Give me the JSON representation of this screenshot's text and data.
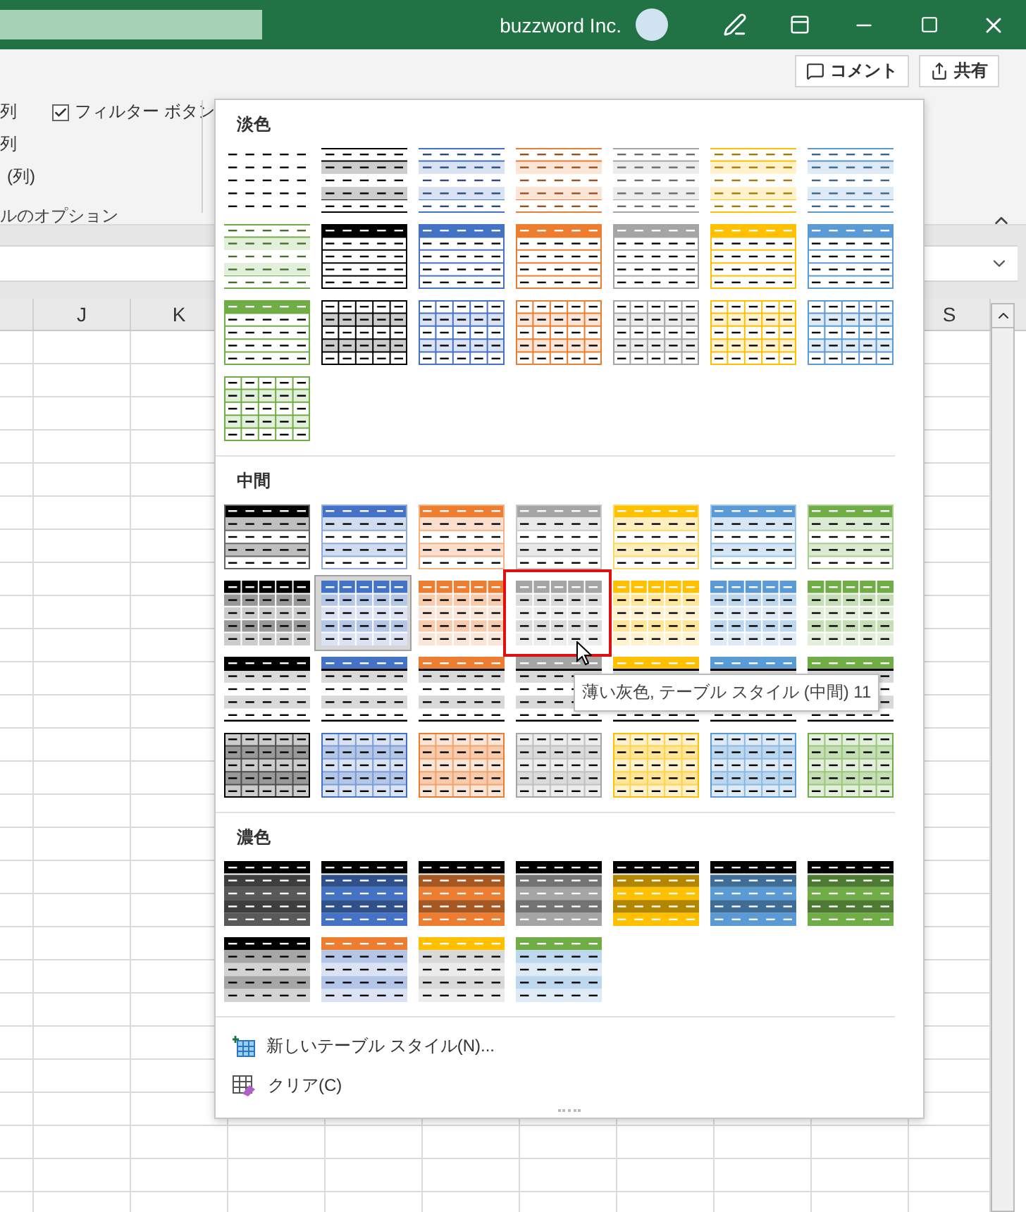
{
  "title_bar": {
    "account": "buzzword Inc."
  },
  "ribbon": {
    "buttons": [
      {
        "kind": "comment",
        "label": "コメント"
      },
      {
        "kind": "share",
        "label": "共有"
      }
    ],
    "lines": [
      {
        "text": "列",
        "checkbox": {
          "label": "フィルター ボタン",
          "checked": true
        }
      },
      {
        "text": "列"
      },
      {
        "text": "(列)"
      }
    ],
    "group_label": "ルのオプション"
  },
  "sheet": {
    "columns": [
      "J",
      "K",
      "S"
    ]
  },
  "gallery": {
    "sections": [
      {
        "title": "淡色",
        "styles": [
          {
            "kind": "plain",
            "color": "#000000",
            "selected": false,
            "hovered": false
          },
          {
            "kind": "banded",
            "color": "#000000",
            "selected": false,
            "hovered": false
          },
          {
            "kind": "banded",
            "color": "#4472c4",
            "selected": false,
            "hovered": false
          },
          {
            "kind": "banded",
            "color": "#ed7d31",
            "selected": false,
            "hovered": false
          },
          {
            "kind": "banded",
            "color": "#a5a5a5",
            "selected": false,
            "hovered": false
          },
          {
            "kind": "banded",
            "color": "#ffc000",
            "selected": false,
            "hovered": false
          },
          {
            "kind": "banded",
            "color": "#5b9bd5",
            "selected": false,
            "hovered": false
          },
          {
            "kind": "banded",
            "color": "#70ad47",
            "selected": false,
            "hovered": false
          },
          {
            "kind": "header",
            "color": "#000000",
            "selected": false,
            "hovered": false
          },
          {
            "kind": "header",
            "color": "#4472c4",
            "selected": false,
            "hovered": false
          },
          {
            "kind": "header",
            "color": "#ed7d31",
            "selected": false,
            "hovered": false
          },
          {
            "kind": "header",
            "color": "#a5a5a5",
            "selected": false,
            "hovered": false
          },
          {
            "kind": "header",
            "color": "#ffc000",
            "selected": false,
            "hovered": false
          },
          {
            "kind": "header",
            "color": "#5b9bd5",
            "selected": false,
            "hovered": false
          },
          {
            "kind": "header",
            "color": "#70ad47",
            "selected": false,
            "hovered": false
          },
          {
            "kind": "grid",
            "color": "#000000",
            "selected": false,
            "hovered": false
          },
          {
            "kind": "grid",
            "color": "#4472c4",
            "selected": false,
            "hovered": false
          },
          {
            "kind": "grid",
            "color": "#ed7d31",
            "selected": false,
            "hovered": false
          },
          {
            "kind": "grid",
            "color": "#a5a5a5",
            "selected": false,
            "hovered": false
          },
          {
            "kind": "grid",
            "color": "#ffc000",
            "selected": false,
            "hovered": false
          },
          {
            "kind": "grid",
            "color": "#5b9bd5",
            "selected": false,
            "hovered": false
          },
          {
            "kind": "grid",
            "color": "#70ad47",
            "selected": false,
            "hovered": false
          }
        ]
      },
      {
        "title": "中間",
        "styles": [
          {
            "kind": "header-banded",
            "color": "#000000",
            "selected": false,
            "hovered": false
          },
          {
            "kind": "header-banded",
            "color": "#4472c4",
            "selected": false,
            "hovered": false
          },
          {
            "kind": "header-banded",
            "color": "#ed7d31",
            "selected": false,
            "hovered": false
          },
          {
            "kind": "header-banded",
            "color": "#a5a5a5",
            "selected": false,
            "hovered": false
          },
          {
            "kind": "header-banded",
            "color": "#ffc000",
            "selected": false,
            "hovered": false
          },
          {
            "kind": "header-banded",
            "color": "#5b9bd5",
            "selected": false,
            "hovered": false
          },
          {
            "kind": "header-banded",
            "color": "#70ad47",
            "selected": false,
            "hovered": false
          },
          {
            "kind": "tinted-grid",
            "color": "#000000",
            "selected": false,
            "hovered": false
          },
          {
            "kind": "tinted-grid",
            "color": "#4472c4",
            "selected": true,
            "hovered": false
          },
          {
            "kind": "tinted-grid",
            "color": "#ed7d31",
            "selected": false,
            "hovered": false
          },
          {
            "kind": "tinted-grid",
            "color": "#a5a5a5",
            "selected": false,
            "hovered": true
          },
          {
            "kind": "tinted-grid",
            "color": "#ffc000",
            "selected": false,
            "hovered": false
          },
          {
            "kind": "tinted-grid",
            "color": "#5b9bd5",
            "selected": false,
            "hovered": false
          },
          {
            "kind": "tinted-grid",
            "color": "#70ad47",
            "selected": false,
            "hovered": false
          },
          {
            "kind": "header-rule",
            "color": "#000000",
            "selected": false,
            "hovered": false
          },
          {
            "kind": "header-rule",
            "color": "#4472c4",
            "selected": false,
            "hovered": false
          },
          {
            "kind": "header-rule",
            "color": "#ed7d31",
            "selected": false,
            "hovered": false
          },
          {
            "kind": "header-rule",
            "color": "#a5a5a5",
            "selected": false,
            "hovered": false
          },
          {
            "kind": "header-rule",
            "color": "#ffc000",
            "selected": false,
            "hovered": false
          },
          {
            "kind": "header-rule",
            "color": "#5b9bd5",
            "selected": false,
            "hovered": false
          },
          {
            "kind": "header-rule",
            "color": "#70ad47",
            "selected": false,
            "hovered": false
          },
          {
            "kind": "light-grid",
            "color": "#000000",
            "selected": false,
            "hovered": false
          },
          {
            "kind": "light-grid",
            "color": "#4472c4",
            "selected": false,
            "hovered": false
          },
          {
            "kind": "light-grid",
            "color": "#ed7d31",
            "selected": false,
            "hovered": false
          },
          {
            "kind": "light-grid",
            "color": "#a5a5a5",
            "selected": false,
            "hovered": false
          },
          {
            "kind": "light-grid",
            "color": "#ffc000",
            "selected": false,
            "hovered": false
          },
          {
            "kind": "light-grid",
            "color": "#5b9bd5",
            "selected": false,
            "hovered": false
          },
          {
            "kind": "light-grid",
            "color": "#70ad47",
            "selected": false,
            "hovered": false
          }
        ]
      },
      {
        "title": "濃色",
        "styles": [
          {
            "kind": "dark-banded",
            "color": "#595959",
            "selected": false,
            "hovered": false
          },
          {
            "kind": "dark-banded",
            "color": "#4472c4",
            "selected": false,
            "hovered": false
          },
          {
            "kind": "dark-banded",
            "color": "#ed7d31",
            "selected": false,
            "hovered": false
          },
          {
            "kind": "dark-banded",
            "color": "#a5a5a5",
            "selected": false,
            "hovered": false
          },
          {
            "kind": "dark-banded",
            "color": "#ffc000",
            "selected": false,
            "hovered": false
          },
          {
            "kind": "dark-banded",
            "color": "#5b9bd5",
            "selected": false,
            "hovered": false
          },
          {
            "kind": "dark-banded",
            "color": "#70ad47",
            "selected": false,
            "hovered": false
          },
          {
            "kind": "header-tint",
            "color": "#000000",
            "body": {
              "color": "#a6a6a6"
            },
            "selected": false,
            "hovered": false
          },
          {
            "kind": "header-tint",
            "color": "#ed7d31",
            "body": {
              "color": "#b4c6e7"
            },
            "selected": false,
            "hovered": false
          },
          {
            "kind": "header-tint",
            "color": "#ffc000",
            "body": {
              "color": "#d9d9d9"
            },
            "selected": false,
            "hovered": false
          },
          {
            "kind": "header-tint",
            "color": "#70ad47",
            "body": {
              "color": "#bdd7ee"
            },
            "selected": false,
            "hovered": false
          }
        ]
      }
    ],
    "tooltip": "薄い灰色, テーブル スタイル (中間) 11",
    "menu": [
      {
        "kind": "new",
        "label": "新しいテーブル スタイル(N)..."
      },
      {
        "kind": "clear",
        "label": "クリア(C)"
      }
    ]
  }
}
